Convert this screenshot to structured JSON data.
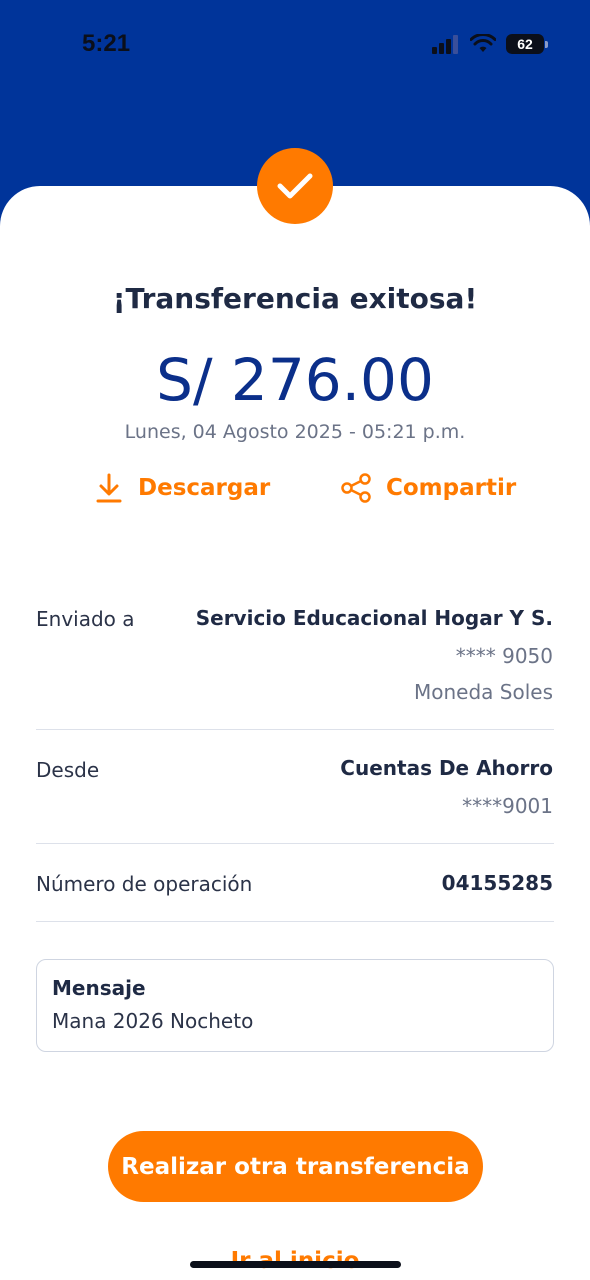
{
  "status_bar": {
    "time": "5:21",
    "battery": "62"
  },
  "header": {
    "title": "¡Transferencia exitosa!",
    "amount": "S/ 276.00",
    "date": "Lunes, 04 Agosto 2025 - 05:21 p.m."
  },
  "actions": {
    "download": "Descargar",
    "share": "Compartir"
  },
  "details": {
    "sent_to": {
      "label": "Enviado a",
      "name": "Servicio Educacional Hogar Y S.",
      "account": "**** 9050",
      "currency": "Moneda Soles"
    },
    "from": {
      "label": "Desde",
      "name": "Cuentas De Ahorro",
      "account": "****9001"
    },
    "operation": {
      "label": "Número de operación",
      "number": "04155285"
    }
  },
  "message": {
    "title": "Mensaje",
    "text": "Mana 2026 Nocheto"
  },
  "buttons": {
    "primary": "Realizar otra transferencia",
    "secondary": "Ir al inicio"
  },
  "colors": {
    "brand_blue": "#00349a",
    "accent_orange": "#ff7a00",
    "amount_blue": "#0b2f8a"
  },
  "icons": {
    "success": "checkmark-icon",
    "download": "download-icon",
    "share": "share-icon"
  }
}
